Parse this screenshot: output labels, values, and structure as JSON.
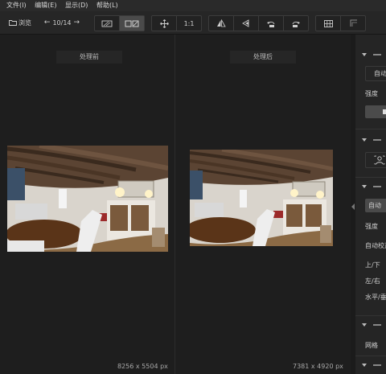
{
  "menu": [
    "文件(I)",
    "编辑(E)",
    "显示(D)",
    "帮助(L)"
  ],
  "toolbar": {
    "browse_label": "浏览",
    "page_counter": "10/14",
    "zoom_label": "1:1"
  },
  "panes": {
    "before_label": "处理前",
    "after_label": "处理后",
    "before_dimensions": "8256 x 5504 px",
    "after_dimensions": "7381 x 4920 px"
  },
  "right_panel": {
    "auto_1": "自动",
    "strength_1": "强度",
    "auto_2": "自动",
    "strength_2": "强度",
    "auto_correct": "自动校正",
    "up_down": "上/下",
    "left_right": "左/右",
    "horizontal": "水平/垂",
    "grid": "网格"
  },
  "colors": {
    "background": "#1e1e1e",
    "panel": "#252525",
    "toolbar": "#262626"
  }
}
